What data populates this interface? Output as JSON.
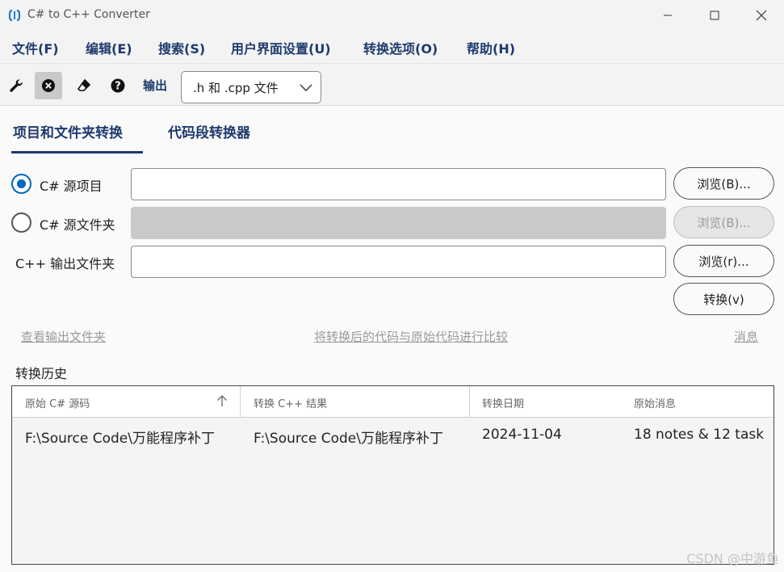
{
  "window": {
    "title": "C# to C++ Converter"
  },
  "menu": [
    "文件(F)",
    "编辑(E)",
    "搜索(S)",
    "用户界面设置(U)",
    "转换选项(O)",
    "帮助(H)"
  ],
  "toolbar": {
    "icons": [
      "wrench-icon",
      "cancel-icon",
      "eraser-icon",
      "help-icon"
    ],
    "output_label": "输出",
    "output_select": ".h 和 .cpp 文件"
  },
  "tabs": [
    "项目和文件夹转换",
    "代码段转换器"
  ],
  "form": {
    "source_project_label": "C# 源项目",
    "source_folder_label": "C# 源文件夹",
    "output_folder_label": "C++ 输出文件夹",
    "browse_b": "浏览(B)...",
    "browse_b_disabled": "浏览(B)...",
    "browse_r": "浏览(r)...",
    "convert": "转换(v)"
  },
  "links": {
    "view_output": "查看输出文件夹",
    "compare": "将转换后的代码与原始代码进行比较",
    "messages": "消息"
  },
  "history": {
    "label": "转换历史",
    "columns": [
      "原始 C# 源码",
      "转换 C++ 结果",
      "转换日期",
      "原始消息"
    ],
    "rows": [
      [
        "F:\\Source Code\\万能程序补丁",
        "F:\\Source Code\\万能程序补丁",
        "2024-11-04",
        "18 notes & 12 task"
      ]
    ]
  },
  "watermark": "CSDN @中游鱼"
}
